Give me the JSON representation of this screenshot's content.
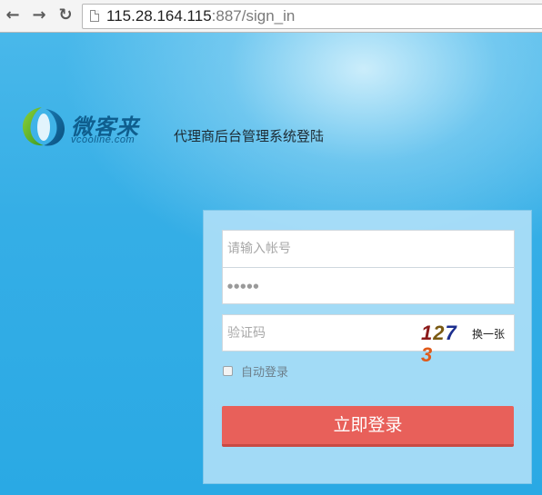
{
  "browser": {
    "back_glyph": "←",
    "forward_glyph": "→",
    "reload_glyph": "↻",
    "url_host": "115.28.164.115",
    "url_rest": ":887/sign_in"
  },
  "header": {
    "logo_text": "微客来",
    "logo_domain": "vcooline.com",
    "system_title": "代理商后台管理系统登陆"
  },
  "login": {
    "username_placeholder": "请输入帐号",
    "password_value": "●●●●●",
    "captcha_placeholder": "验证码",
    "captcha_digits": [
      "1",
      "2",
      "7",
      "3"
    ],
    "refresh_label": "换一张",
    "remember_label": "自动登录",
    "submit_label": "立即登录"
  },
  "colors": {
    "background": "#2eaee6",
    "submit_button": "#e8605a",
    "captcha_1": "#8b1a1a",
    "captcha_2": "#7a5a12",
    "captcha_7": "#1d2f8f",
    "captcha_3": "#e05a1a"
  },
  "icons": [
    "back-arrow-icon",
    "forward-arrow-icon",
    "reload-icon",
    "page-icon",
    "logo-mark-icon"
  ]
}
